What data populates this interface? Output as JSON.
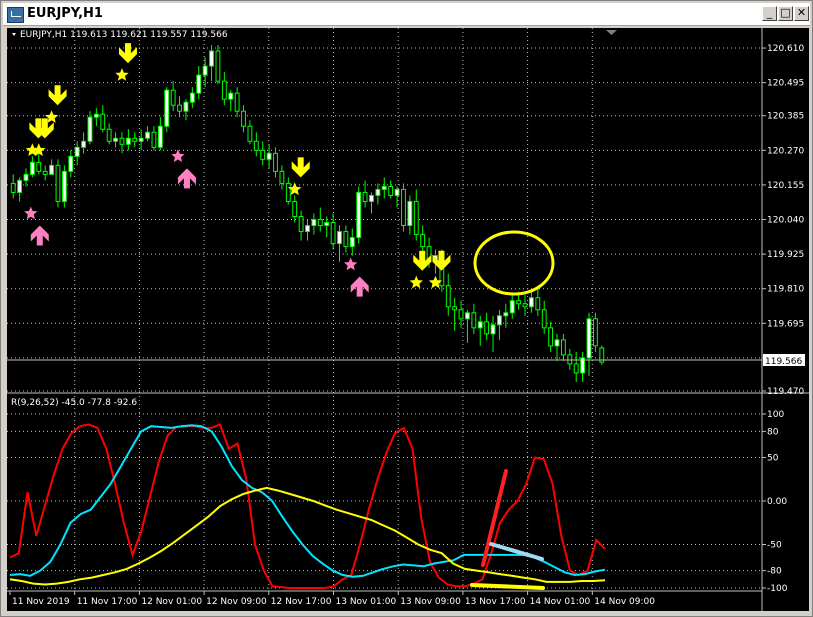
{
  "window": {
    "title": "EURJPY,H1",
    "controls": {
      "minimize": "_",
      "restore": "□",
      "close": "✕"
    }
  },
  "price_header": "EURJPY,H1  119.613 119.621 119.557 119.566",
  "indicator_header": "R(9,26,52) -45.0 -77.8 -92.6",
  "current_price_label": "119.566",
  "colors": {
    "background": "#000000",
    "bull_candle": "#ffffff",
    "bear_candle": "#000000",
    "wick": "#00ff00",
    "grid": "#c0c0c0",
    "buy_arrow": "#ff80c0",
    "sell_arrow": "#ffff00",
    "series_fast": "#ff0000",
    "series_mid": "#00e5ff",
    "series_slow": "#ffff00",
    "highlight_circle": "#ffff00",
    "annotation_red": "#ff2020",
    "annotation_blue": "#a0d8f0",
    "annotation_yellow": "#ffff00"
  },
  "chart_data": [
    {
      "type": "candlestick",
      "symbol": "EURJPY",
      "timeframe": "H1",
      "y_ticks": [
        "120.610",
        "120.495",
        "120.385",
        "120.270",
        "120.155",
        "120.040",
        "119.925",
        "119.810",
        "119.695",
        "119.580",
        "119.470"
      ],
      "ylim": [
        119.47,
        120.65
      ],
      "x_ticks": [
        "11 Nov 2019",
        "11 Nov 17:00",
        "12 Nov 01:00",
        "12 Nov 09:00",
        "12 Nov 17:00",
        "13 Nov 01:00",
        "13 Nov 09:00",
        "13 Nov 17:00",
        "14 Nov 01:00",
        "14 Nov 09:00"
      ],
      "ohlc": [
        [
          120.16,
          120.19,
          120.11,
          120.13
        ],
        [
          120.13,
          120.18,
          120.1,
          120.17
        ],
        [
          120.17,
          120.21,
          120.15,
          120.19
        ],
        [
          120.19,
          120.25,
          120.18,
          120.23
        ],
        [
          120.23,
          120.26,
          120.19,
          120.2
        ],
        [
          120.2,
          120.22,
          120.17,
          120.19
        ],
        [
          120.19,
          120.24,
          120.19,
          120.22
        ],
        [
          120.22,
          120.24,
          120.08,
          120.1
        ],
        [
          120.1,
          120.22,
          120.08,
          120.2
        ],
        [
          120.2,
          120.27,
          120.18,
          120.25
        ],
        [
          120.25,
          120.3,
          120.22,
          120.28
        ],
        [
          120.28,
          120.33,
          120.26,
          120.3
        ],
        [
          120.3,
          120.4,
          120.29,
          120.38
        ],
        [
          120.38,
          120.41,
          120.35,
          120.39
        ],
        [
          120.39,
          120.42,
          120.33,
          120.34
        ],
        [
          120.34,
          120.36,
          120.29,
          120.3
        ],
        [
          120.3,
          120.33,
          120.28,
          120.31
        ],
        [
          120.31,
          120.33,
          120.26,
          120.29
        ],
        [
          120.29,
          120.34,
          120.27,
          120.31
        ],
        [
          120.31,
          120.33,
          120.28,
          120.3
        ],
        [
          120.3,
          120.34,
          120.27,
          120.31
        ],
        [
          120.31,
          120.35,
          120.3,
          120.33
        ],
        [
          120.33,
          120.35,
          120.27,
          120.28
        ],
        [
          120.28,
          120.38,
          120.27,
          120.35
        ],
        [
          120.35,
          120.48,
          120.33,
          120.47
        ],
        [
          120.47,
          120.5,
          120.4,
          120.42
        ],
        [
          120.42,
          120.45,
          120.38,
          120.4
        ],
        [
          120.4,
          120.44,
          120.37,
          120.43
        ],
        [
          120.43,
          120.48,
          120.41,
          120.46
        ],
        [
          120.46,
          120.55,
          120.44,
          120.52
        ],
        [
          120.52,
          120.58,
          120.48,
          120.55
        ],
        [
          120.55,
          120.62,
          120.5,
          120.6
        ],
        [
          120.6,
          120.62,
          120.49,
          120.5
        ],
        [
          120.5,
          120.53,
          120.42,
          120.44
        ],
        [
          120.44,
          120.47,
          120.4,
          120.46
        ],
        [
          120.46,
          120.48,
          120.38,
          120.4
        ],
        [
          120.4,
          120.42,
          120.33,
          120.35
        ],
        [
          120.35,
          120.37,
          120.29,
          120.3
        ],
        [
          120.3,
          120.33,
          120.25,
          120.27
        ],
        [
          120.27,
          120.3,
          120.22,
          120.24
        ],
        [
          120.24,
          120.29,
          120.21,
          120.26
        ],
        [
          120.26,
          120.28,
          120.18,
          120.2
        ],
        [
          120.2,
          120.22,
          120.14,
          120.16
        ],
        [
          120.16,
          120.18,
          120.09,
          120.1
        ],
        [
          120.1,
          120.12,
          120.03,
          120.05
        ],
        [
          120.05,
          120.07,
          119.97,
          120.0
        ],
        [
          120.0,
          120.04,
          119.97,
          120.02
        ],
        [
          120.02,
          120.06,
          119.99,
          120.04
        ],
        [
          120.04,
          120.08,
          120.0,
          120.02
        ],
        [
          120.02,
          120.05,
          119.98,
          120.03
        ],
        [
          120.03,
          120.06,
          119.94,
          119.96
        ],
        [
          119.96,
          120.02,
          119.9,
          120.0
        ],
        [
          120.0,
          120.02,
          119.93,
          119.95
        ],
        [
          119.95,
          120.01,
          119.92,
          119.98
        ],
        [
          119.98,
          120.15,
          119.96,
          120.13
        ],
        [
          120.13,
          120.17,
          120.08,
          120.1
        ],
        [
          120.1,
          120.13,
          120.06,
          120.12
        ],
        [
          120.12,
          120.16,
          120.09,
          120.14
        ],
        [
          120.14,
          120.18,
          120.11,
          120.15
        ],
        [
          120.15,
          120.17,
          120.11,
          120.12
        ],
        [
          120.12,
          120.15,
          120.08,
          120.14
        ],
        [
          120.14,
          120.16,
          120.0,
          120.02
        ],
        [
          120.02,
          120.12,
          119.99,
          120.1
        ],
        [
          120.1,
          120.14,
          119.97,
          119.99
        ],
        [
          119.99,
          120.02,
          119.93,
          119.95
        ],
        [
          119.95,
          119.98,
          119.88,
          119.9
        ],
        [
          119.9,
          119.94,
          119.86,
          119.92
        ],
        [
          119.92,
          119.94,
          119.8,
          119.82
        ],
        [
          119.82,
          119.86,
          119.72,
          119.75
        ],
        [
          119.75,
          119.78,
          119.67,
          119.74
        ],
        [
          119.74,
          119.77,
          119.68,
          119.71
        ],
        [
          119.71,
          119.74,
          119.63,
          119.73
        ],
        [
          119.73,
          119.76,
          119.66,
          119.68
        ],
        [
          119.68,
          119.72,
          119.62,
          119.7
        ],
        [
          119.7,
          119.73,
          119.64,
          119.66
        ],
        [
          119.66,
          119.72,
          119.6,
          119.69
        ],
        [
          119.69,
          119.74,
          119.64,
          119.72
        ],
        [
          119.72,
          119.76,
          119.68,
          119.73
        ],
        [
          119.73,
          119.79,
          119.71,
          119.77
        ],
        [
          119.77,
          119.8,
          119.74,
          119.76
        ],
        [
          119.76,
          119.79,
          119.72,
          119.75
        ],
        [
          119.75,
          119.8,
          119.73,
          119.78
        ],
        [
          119.78,
          119.82,
          119.72,
          119.74
        ],
        [
          119.74,
          119.77,
          119.66,
          119.68
        ],
        [
          119.68,
          119.7,
          119.6,
          119.62
        ],
        [
          119.62,
          119.66,
          119.57,
          119.64
        ],
        [
          119.64,
          119.66,
          119.57,
          119.59
        ],
        [
          119.59,
          119.61,
          119.54,
          119.56
        ],
        [
          119.56,
          119.6,
          119.5,
          119.53
        ],
        [
          119.53,
          119.6,
          119.5,
          119.58
        ],
        [
          119.58,
          119.73,
          119.52,
          119.71
        ],
        [
          119.71,
          119.73,
          119.6,
          119.62
        ],
        [
          119.613,
          119.621,
          119.557,
          119.566
        ]
      ],
      "signals": [
        {
          "kind": "sell",
          "bar": 3,
          "price": 120.27
        },
        {
          "kind": "sell",
          "bar": 4,
          "price": 120.27
        },
        {
          "kind": "sell",
          "bar": 6,
          "price": 120.38
        },
        {
          "kind": "buy",
          "bar": 4,
          "price": 120.06
        },
        {
          "kind": "sell",
          "bar": 17,
          "price": 120.52
        },
        {
          "kind": "buy",
          "bar": 27,
          "price": 120.25
        },
        {
          "kind": "sell",
          "bar": 44,
          "price": 120.14
        },
        {
          "kind": "buy",
          "bar": 54,
          "price": 119.89
        },
        {
          "kind": "sell",
          "bar": 63,
          "price": 119.83
        },
        {
          "kind": "sell",
          "bar": 66,
          "price": 119.83
        }
      ]
    },
    {
      "type": "line",
      "y_ticks": [
        "100",
        "80",
        "50",
        "0.00",
        "-50",
        "-80",
        "-100"
      ],
      "ylim": [
        -100,
        100
      ],
      "series": [
        {
          "values": [
            -65,
            -60,
            10,
            -40,
            -5,
            30,
            60,
            78,
            86,
            88,
            84,
            60,
            20,
            -25,
            -62,
            -35,
            5,
            45,
            75,
            85,
            86,
            86,
            84,
            84,
            88,
            60,
            66,
            25,
            -50,
            -80,
            -98,
            -99,
            -100,
            -100,
            -100,
            -100,
            -100,
            -98,
            -90,
            -85,
            -50,
            -10,
            25,
            55,
            78,
            84,
            60,
            -20,
            -70,
            -88,
            -96,
            -98,
            -98,
            -95,
            -90,
            -60,
            -25,
            -10,
            0,
            20,
            50,
            48,
            20,
            -40,
            -80,
            -85,
            -80,
            -45,
            -55
          ]
        },
        {
          "values": [
            -85,
            -84,
            -86,
            -80,
            -70,
            -50,
            -25,
            -15,
            -10,
            5,
            20,
            40,
            60,
            80,
            86,
            85,
            84,
            86,
            87,
            86,
            80,
            62,
            40,
            24,
            15,
            10,
            0,
            -18,
            -35,
            -50,
            -63,
            -72,
            -80,
            -85,
            -87,
            -86,
            -82,
            -78,
            -75,
            -73,
            -74,
            -75,
            -72,
            -70,
            -68,
            -62,
            -62,
            -62,
            -62,
            -62,
            -62,
            -62,
            -65,
            -70,
            -76,
            -82,
            -85,
            -84,
            -81,
            -79
          ]
        },
        {
          "values": [
            -90,
            -92,
            -95,
            -96,
            -95,
            -93,
            -90,
            -88,
            -85,
            -82,
            -78,
            -72,
            -65,
            -57,
            -48,
            -38,
            -28,
            -18,
            -6,
            2,
            8,
            12,
            15,
            12,
            8,
            4,
            0,
            -5,
            -10,
            -14,
            -18,
            -22,
            -28,
            -34,
            -42,
            -50,
            -56,
            -60,
            -72,
            -78,
            -80,
            -82,
            -84,
            -86,
            -88,
            -90,
            -93,
            -93,
            -93,
            -92,
            -92,
            -91
          ]
        }
      ],
      "annotations": [
        {
          "kind": "line",
          "color": "red"
        },
        {
          "kind": "line",
          "color": "light-blue"
        },
        {
          "kind": "line",
          "color": "yellow"
        }
      ]
    }
  ]
}
